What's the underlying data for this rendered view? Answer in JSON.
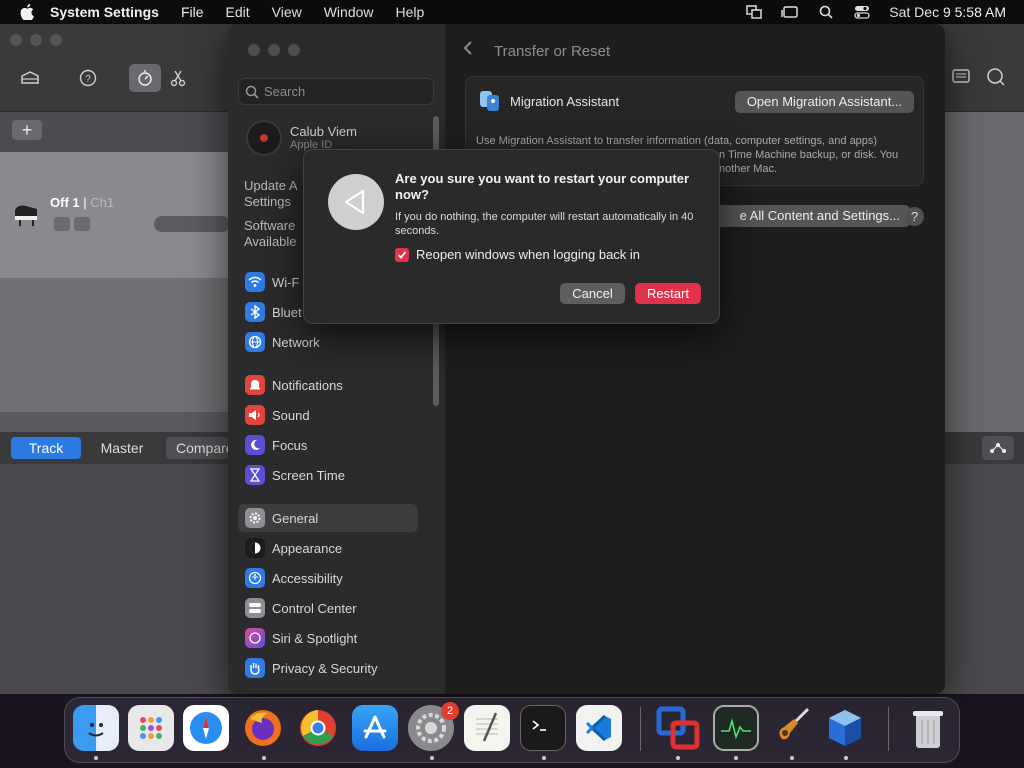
{
  "menubar": {
    "app_name": "System Settings",
    "items": [
      "File",
      "Edit",
      "View",
      "Window",
      "Help"
    ],
    "clock": "Sat Dec 9  5:58 AM"
  },
  "background_window": {
    "track_name": "Off 1",
    "track_channel": "Ch1",
    "tabs": [
      "Track",
      "Master",
      "Compare"
    ],
    "add_label": "+"
  },
  "sidebar": {
    "search_placeholder": "Search",
    "account_name": "Calub Viem",
    "account_sub": "Apple ID",
    "update_line1": "Update A",
    "update_line2": "Settings",
    "software_line1": "Software",
    "software_line2": "Available",
    "items": [
      {
        "label": "Wi-F",
        "icon": "wifi-icon",
        "color": "#2f7ae5"
      },
      {
        "label": "Bluet",
        "icon": "bluetooth-icon",
        "color": "#2f7ae5"
      },
      {
        "label": "Network",
        "icon": "globe-icon",
        "color": "#2f7ae5"
      },
      {
        "label": "Notifications",
        "icon": "bell-icon",
        "color": "#e0443a"
      },
      {
        "label": "Sound",
        "icon": "speaker-icon",
        "color": "#e0443a"
      },
      {
        "label": "Focus",
        "icon": "moon-icon",
        "color": "#5b4fd6"
      },
      {
        "label": "Screen Time",
        "icon": "hourglass-icon",
        "color": "#5b4fd6"
      },
      {
        "label": "General",
        "icon": "gear-icon",
        "color": "#8e8e93"
      },
      {
        "label": "Appearance",
        "icon": "appearance-icon",
        "color": "#1c1c1e"
      },
      {
        "label": "Accessibility",
        "icon": "accessibility-icon",
        "color": "#2f7ae5"
      },
      {
        "label": "Control Center",
        "icon": "control-center-icon",
        "color": "#8e8e93"
      },
      {
        "label": "Siri & Spotlight",
        "icon": "siri-icon",
        "color": "#a346d6"
      },
      {
        "label": "Privacy & Security",
        "icon": "hand-icon",
        "color": "#2f7ae5"
      }
    ]
  },
  "main": {
    "title": "Transfer or Reset",
    "migration_title": "Migration Assistant",
    "migration_button": "Open Migration Assistant...",
    "migration_desc": "Use Migration Assistant to transfer information (data, computer settings, and apps)",
    "migration_desc2": "n Time Machine backup, or disk. You",
    "migration_desc3": "nother Mac.",
    "erase_button": "e All Content and Settings...",
    "help": "?"
  },
  "dialog": {
    "title": "Are you sure you want to restart your computer now?",
    "message": "If you do nothing, the computer will restart automatically in 40 seconds.",
    "checkbox_label": "Reopen windows when logging back in",
    "checkbox_checked": true,
    "cancel": "Cancel",
    "restart": "Restart"
  },
  "dock": {
    "apps": [
      "finder-icon",
      "launchpad-icon",
      "safari-icon",
      "firefox-icon",
      "chrome-icon",
      "app-store-icon",
      "system-settings-icon",
      "textedit-icon",
      "terminal-icon",
      "vscode-icon",
      "parallels-icon",
      "activity-monitor-icon",
      "garageband-icon",
      "virtualbox-icon",
      "trash-icon"
    ],
    "settings_badge": "2"
  }
}
